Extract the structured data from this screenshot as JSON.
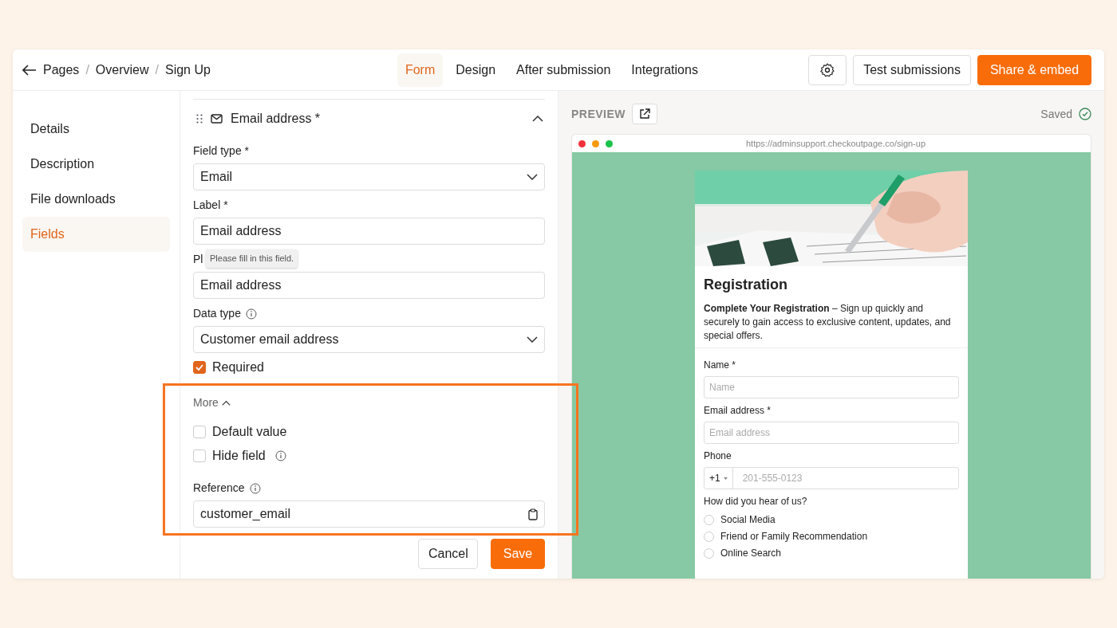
{
  "breadcrumb": [
    {
      "kind": "link",
      "text": "Pages"
    },
    {
      "kind": "separator",
      "text": "/"
    },
    {
      "kind": "link",
      "text": "Overview"
    },
    {
      "kind": "separator",
      "text": "/"
    },
    {
      "kind": "current",
      "text": "Sign Up"
    }
  ],
  "tabs": [
    {
      "label": "Form",
      "selected": true
    },
    {
      "label": "Design",
      "selected": false
    },
    {
      "label": "After submission",
      "selected": false
    },
    {
      "label": "Integrations",
      "selected": false
    }
  ],
  "toolbar": {
    "test_button": "Test submissions",
    "share_button": "Share & embed"
  },
  "sidebar": {
    "items": [
      {
        "label": "Details",
        "selected": false
      },
      {
        "label": "Description",
        "selected": false
      },
      {
        "label": "File downloads",
        "selected": false
      },
      {
        "label": "Fields",
        "selected": true
      }
    ]
  },
  "field_editor": {
    "title": "Email address *",
    "expanded": true,
    "fields": [
      {
        "kind": "select",
        "label": "Field type *",
        "value": "Email"
      },
      {
        "kind": "input",
        "label": "Label *",
        "value": "Email address"
      },
      {
        "kind": "input",
        "label": "Pl",
        "value": "Email address",
        "tooltip": "Please fill in this field."
      },
      {
        "kind": "select",
        "label": "Data type",
        "info": true,
        "value": "Customer email address"
      },
      {
        "kind": "checkbox",
        "label": "Required",
        "checked": true
      }
    ],
    "more": {
      "label": "More",
      "expanded": true
    },
    "more_fields": [
      {
        "kind": "checkbox",
        "label": "Default value",
        "checked": false
      },
      {
        "kind": "checkbox",
        "label": "Hide field",
        "checked": false,
        "info": true
      },
      {
        "kind": "input",
        "label": "Reference",
        "info": true,
        "value": "customer_email",
        "copy": true
      }
    ],
    "buttons": {
      "cancel": "Cancel",
      "save": "Save"
    }
  },
  "preview": {
    "heading": "PREVIEW",
    "status": "Saved",
    "url": "https://adminsupport.checkoutpage.co/sign-up",
    "form": {
      "title": "Registration",
      "intro": "**Complete Your Registration** – Sign up quickly and securely to gain access to exclusive content, updates, and special offers.",
      "fields": [
        {
          "kind": "text",
          "label": "Name *",
          "placeholder": "Name"
        },
        {
          "kind": "text",
          "label": "Email address *",
          "placeholder": "Email address"
        },
        {
          "kind": "phone",
          "label": "Phone",
          "prefix": "+1",
          "placeholder": "201-555-0123"
        },
        {
          "kind": "radio",
          "label": "How did you hear of us?",
          "options": [
            {
              "label": "Social Media",
              "selected": false
            },
            {
              "label": "Friend or Family Recommendation",
              "selected": false
            },
            {
              "label": "Online Search",
              "selected": false
            }
          ]
        }
      ]
    }
  }
}
